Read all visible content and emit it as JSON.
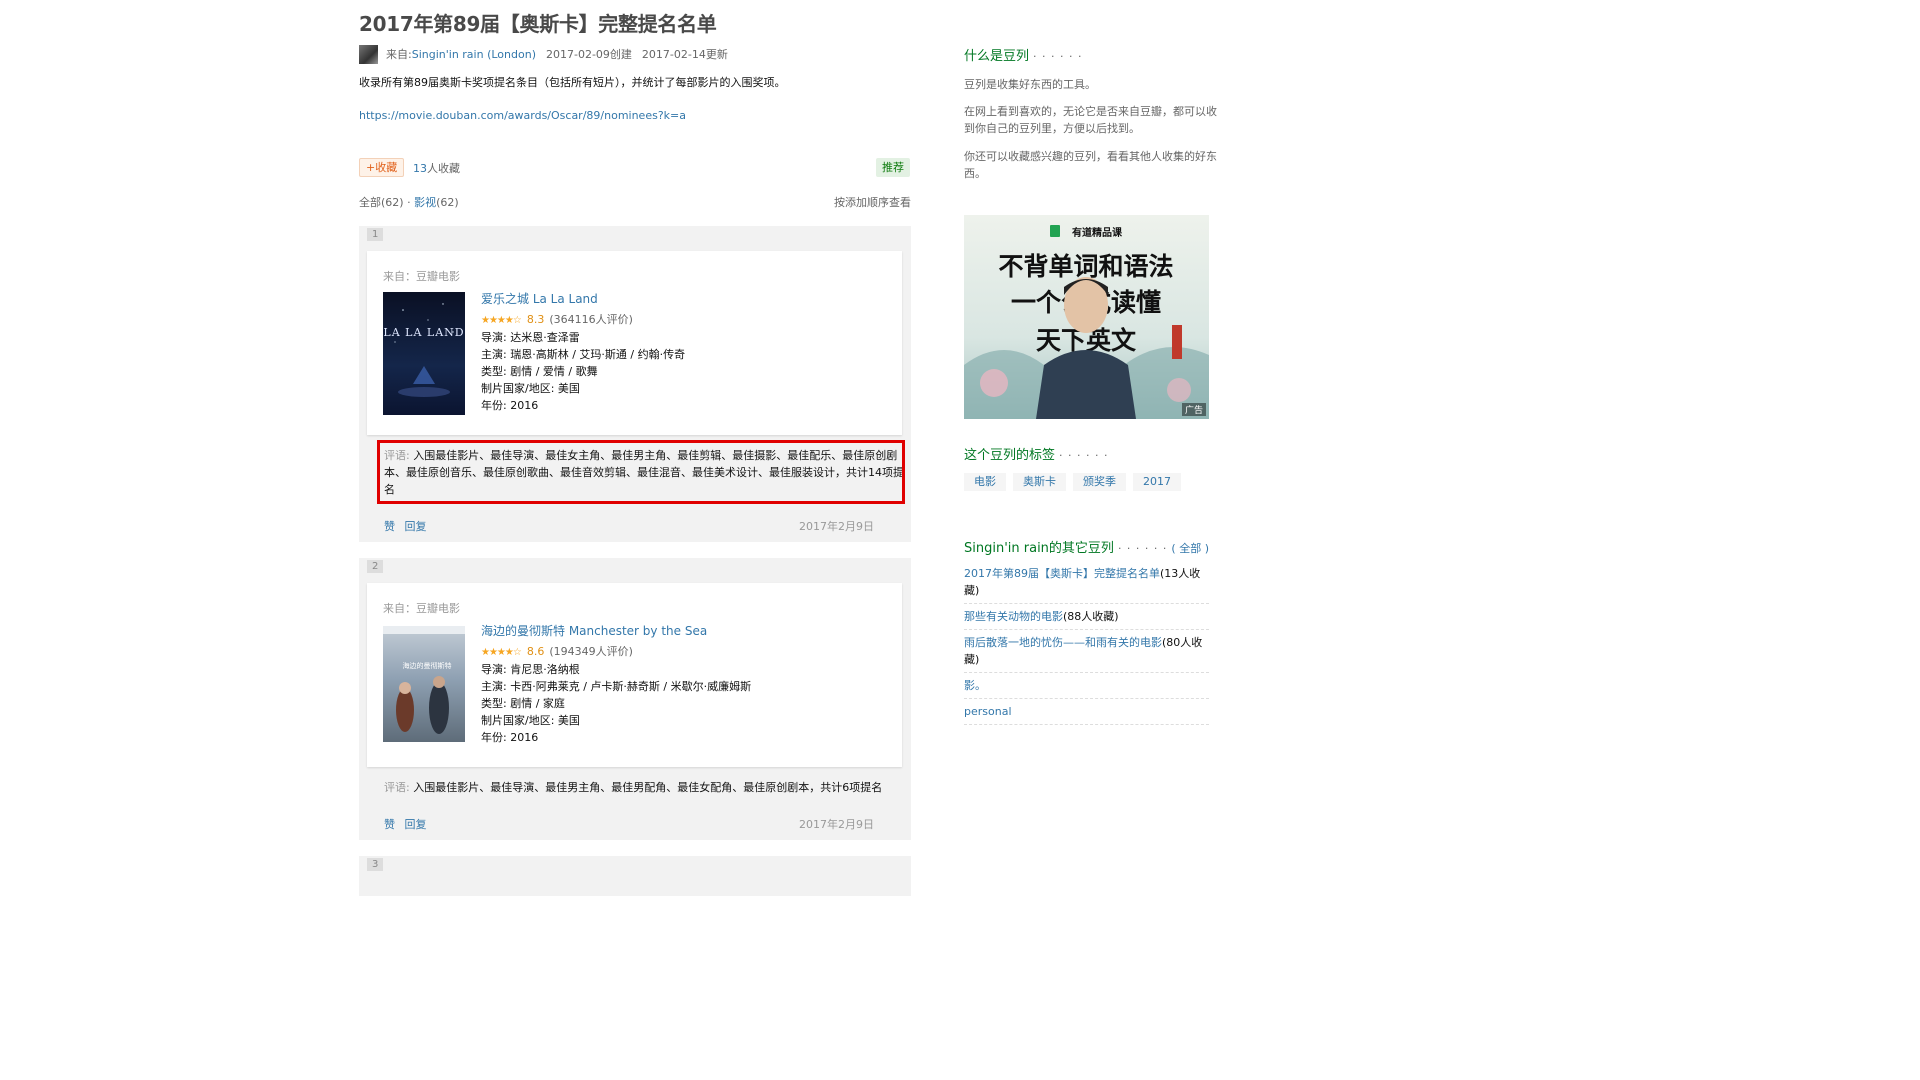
{
  "page_title": "2017年第89届【奥斯卡】完整提名名单",
  "meta": {
    "from_label": "来自: ",
    "author": "Singin'in rain (London)",
    "created": "2017-02-09创建",
    "updated": "2017-02-14更新"
  },
  "intro": "收录所有第89届奥斯卡奖项提名条目（包括所有短片），并统计了每部影片的入围奖项。",
  "link": "https://movie.douban.com/awards/Oscar/89/nominees?k=a",
  "fav": {
    "button": "+收藏",
    "count": "13",
    "count_suffix": "人收藏",
    "recommend": "推荐"
  },
  "filter": {
    "all": "全部(62)",
    "sep": " · ",
    "film_label": "影视",
    "film_count": "(62)",
    "sort": "按添加顺序查看"
  },
  "items": [
    {
      "num": "1",
      "source_label": "来自：",
      "source": "豆瓣电影",
      "title": "爱乐之城 La La Land",
      "stars": "★★★★☆",
      "rating": "8.3",
      "rating_count": "(364116人评价)",
      "director": "导演: 达米恩·查泽雷",
      "cast": "主演: 瑞恩·高斯林 / 艾玛·斯通 / 约翰·传奇",
      "genre": "类型: 剧情 / 爱情 / 歌舞",
      "country": "制片国家/地区: 美国",
      "year": "年份: 2016",
      "poster_text": "LA LA LAND",
      "comment_label": "评语:",
      "comment_line1": "入围最佳影片、最佳导演、最佳女主角、最佳男主角、最佳剪辑、最佳摄影、最佳配乐、最佳原创剧",
      "comment_line2": "本、最佳原创音乐、最佳原创歌曲、最佳音效剪辑、最佳混音、最佳美术设计、最佳服装设计，共计14项提",
      "comment_line3": "名",
      "like": "赞",
      "reply": "回复",
      "date": "2017年2月9日"
    },
    {
      "num": "2",
      "source_label": "来自：",
      "source": "豆瓣电影",
      "title": "海边的曼彻斯特 Manchester by the Sea",
      "stars": "★★★★☆",
      "rating": "8.6",
      "rating_count": "(194349人评价)",
      "director": "导演: 肯尼思·洛纳根",
      "cast": "主演: 卡西·阿弗莱克 / 卢卡斯·赫奇斯 / 米歇尔·威廉姆斯",
      "genre": "类型: 剧情 / 家庭",
      "country": "制片国家/地区: 美国",
      "year": "年份: 2016",
      "poster_text": "海边的曼彻斯特",
      "comment_label": "评语:",
      "comment_line1": "入围最佳影片、最佳导演、最佳男主角、最佳男配角、最佳女配角、最佳原创剧本，共计6项提名",
      "like": "赞",
      "reply": "回复",
      "date": "2017年2月9日"
    },
    {
      "num": "3"
    }
  ],
  "sidebar": {
    "what_title": "什么是豆列",
    "dots": "· · · · · ·",
    "what_p1": "豆列是收集好东西的工具。",
    "what_p2a": "在网上看到喜欢的，无论它是否来自豆瓣，都可以收",
    "what_p2b": "到你自己的豆列里，方便以后找到。",
    "what_p3a": "你还可以收藏感兴趣的豆列，看看其他人收集的好东",
    "what_p3b": "西。",
    "ad": {
      "brand": "有道精品课",
      "line1": "不背单词和语法",
      "line2": "一个公式读懂",
      "line3": "天下英文",
      "label": "广告"
    },
    "tags_title": "这个豆列的标签",
    "tags": [
      "电影",
      "奥斯卡",
      "颁奖季",
      "2017"
    ],
    "others_title": "Singin'in rain的其它豆列",
    "others_all": "( 全部 )",
    "others": [
      {
        "title": "2017年第89届【奥斯卡】完整提名名单",
        "count": "(13人收藏)"
      },
      {
        "title": "那些有关动物的电影",
        "count": "(88人收藏)"
      },
      {
        "title": "雨后散落一地的忧伤——和雨有关的电影",
        "count": "(80人收",
        "count2": "藏)"
      },
      {
        "title": "影。",
        "count": ""
      },
      {
        "title": "personal",
        "count": ""
      }
    ]
  }
}
